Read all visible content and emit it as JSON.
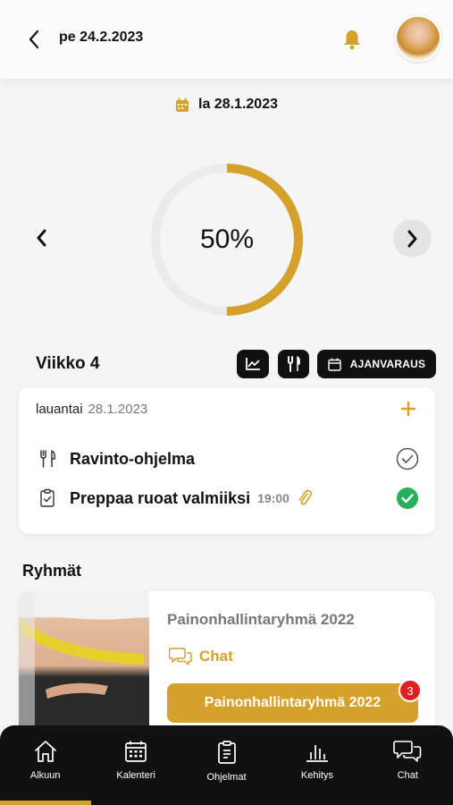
{
  "header": {
    "date": "pe 24.2.2023",
    "back_icon": "chevron-left-icon",
    "bell_icon": "bell-icon",
    "accent": "#d4a12a"
  },
  "selected_date": "la 28.1.2023",
  "progress": {
    "label": "50%",
    "value": 0.5
  },
  "week": {
    "title": "Viikko 4",
    "booking_label": "AJANVARAUS"
  },
  "day": {
    "weekday": "lauantai",
    "date": "28.1.2023",
    "tasks": [
      {
        "title": "Ravinto-ohjelma",
        "time": "",
        "done": false
      },
      {
        "title": "Preppaa ruoat valmiiksi",
        "time": "19:00",
        "done": true
      }
    ]
  },
  "groups": {
    "title": "Ryhmät",
    "items": [
      {
        "name": "Painonhallintaryhmä 2022",
        "chat_label": "Chat",
        "button_label": "Painonhallintaryhmä 2022",
        "badge": "3"
      }
    ]
  },
  "nav": [
    {
      "label": "Alkuun",
      "icon": "home-icon",
      "active": true
    },
    {
      "label": "Kalenteri",
      "icon": "calendar-icon"
    },
    {
      "label": "Ohjelmat",
      "icon": "clipboard-icon"
    },
    {
      "label": "Kehitys",
      "icon": "bar-chart-icon"
    },
    {
      "label": "Chat",
      "icon": "chat-icon"
    }
  ]
}
